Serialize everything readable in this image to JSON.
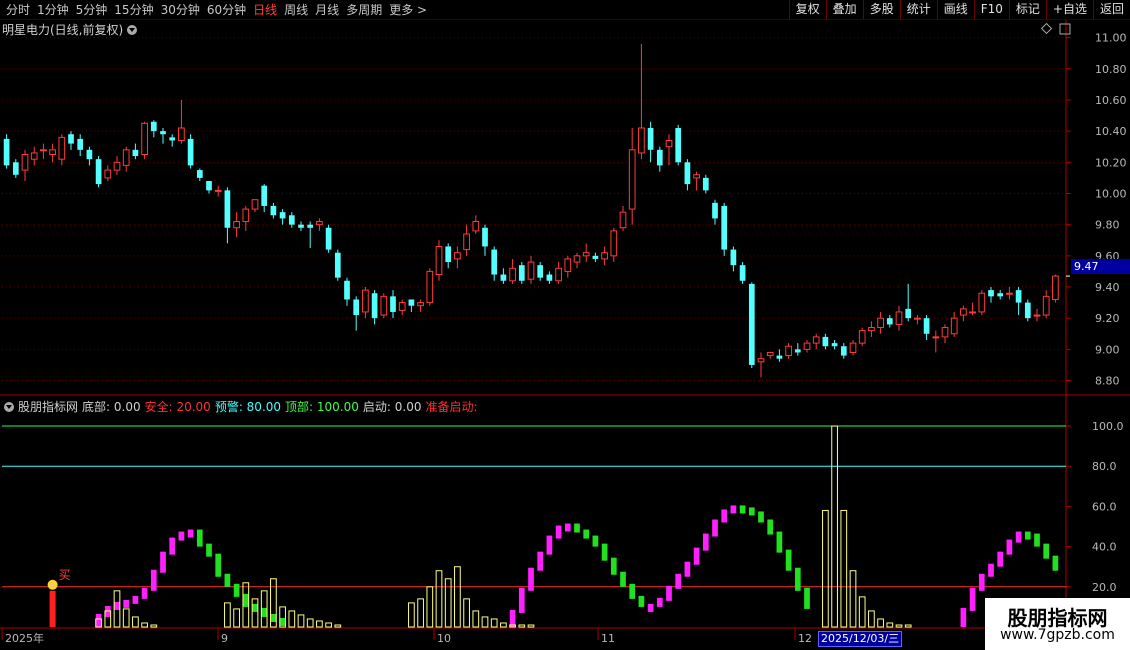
{
  "toolbar": {
    "periods": [
      "分时",
      "1分钟",
      "5分钟",
      "15分钟",
      "30分钟",
      "60分钟",
      "日线",
      "周线",
      "月线",
      "多周期",
      "更多 >"
    ],
    "active_period": "日线",
    "tools": [
      "复权",
      "叠加",
      "多股",
      "统计",
      "画线",
      "F10",
      "标记",
      "+自选",
      "返回"
    ]
  },
  "main_panel": {
    "title": "明星电力(日线,前复权)",
    "last_price": "9.47",
    "colors": {
      "up": "#ff3b3b",
      "down": "#54ffff",
      "grid": "#7a0000",
      "axis": "#b00000"
    }
  },
  "indicator_panel": {
    "name": "股朋指标网",
    "fields": [
      {
        "label": "底部:",
        "value": "0.00",
        "color": "#d0d0d0"
      },
      {
        "label": "安全:",
        "value": "20.00",
        "color": "#ff3030"
      },
      {
        "label": "预警:",
        "value": "80.00",
        "color": "#40ffff"
      },
      {
        "label": "顶部:",
        "value": "100.00",
        "color": "#40ff40"
      },
      {
        "label": "启动:",
        "value": "0.00",
        "color": "#d0d0d0"
      },
      {
        "label": "准备启动:",
        "value": "",
        "color": "#ff3030"
      }
    ],
    "signal_label": "买"
  },
  "x_axis": {
    "labels": [
      "2025年",
      "9",
      "10",
      "11",
      "12"
    ],
    "cursor_date": "2025/12/03/三"
  },
  "watermark": {
    "line1": "股朋指标网",
    "line2": "www.7gpzb.com"
  },
  "chart_data": {
    "type": "candlestick",
    "title": "明星电力(日线,前复权)",
    "y_ticks": [
      8.8,
      9.0,
      9.2,
      9.4,
      9.6,
      9.8,
      10.0,
      10.2,
      10.4,
      10.6,
      10.8,
      11.0
    ],
    "ylim": [
      8.72,
      11.1
    ],
    "candles": [
      [
        10.35,
        10.18,
        10.38,
        10.16
      ],
      [
        10.2,
        10.12,
        10.22,
        10.1
      ],
      [
        10.15,
        10.25,
        10.28,
        10.08
      ],
      [
        10.22,
        10.26,
        10.3,
        10.18
      ],
      [
        10.28,
        10.28,
        10.32,
        10.22
      ],
      [
        10.25,
        10.28,
        10.32,
        10.2
      ],
      [
        10.22,
        10.36,
        10.38,
        10.18
      ],
      [
        10.38,
        10.32,
        10.4,
        10.28
      ],
      [
        10.35,
        10.28,
        10.38,
        10.24
      ],
      [
        10.28,
        10.22,
        10.3,
        10.18
      ],
      [
        10.22,
        10.06,
        10.24,
        10.04
      ],
      [
        10.1,
        10.15,
        10.18,
        10.08
      ],
      [
        10.15,
        10.2,
        10.24,
        10.12
      ],
      [
        10.18,
        10.28,
        10.3,
        10.14
      ],
      [
        10.28,
        10.24,
        10.32,
        10.22
      ],
      [
        10.25,
        10.45,
        10.46,
        10.22
      ],
      [
        10.46,
        10.4,
        10.47,
        10.36
      ],
      [
        10.4,
        10.38,
        10.42,
        10.32
      ],
      [
        10.36,
        10.34,
        10.38,
        10.3
      ],
      [
        10.34,
        10.42,
        10.6,
        10.32
      ],
      [
        10.35,
        10.18,
        10.38,
        10.16
      ],
      [
        10.15,
        10.1,
        10.16,
        10.08
      ],
      [
        10.08,
        10.02,
        10.08,
        10.0
      ],
      [
        10.02,
        10.02,
        10.05,
        9.98
      ],
      [
        10.02,
        9.78,
        10.04,
        9.68
      ],
      [
        9.78,
        9.82,
        9.88,
        9.72
      ],
      [
        9.82,
        9.9,
        9.92,
        9.76
      ],
      [
        9.9,
        9.96,
        9.96,
        9.88
      ],
      [
        10.05,
        9.92,
        10.06,
        9.88
      ],
      [
        9.92,
        9.86,
        9.94,
        9.84
      ],
      [
        9.88,
        9.84,
        9.9,
        9.8
      ],
      [
        9.86,
        9.8,
        9.88,
        9.78
      ],
      [
        9.8,
        9.78,
        9.82,
        9.76
      ],
      [
        9.8,
        9.78,
        9.82,
        9.65
      ],
      [
        9.8,
        9.82,
        9.84,
        9.76
      ],
      [
        9.78,
        9.64,
        9.8,
        9.62
      ],
      [
        9.62,
        9.46,
        9.64,
        9.44
      ],
      [
        9.44,
        9.32,
        9.46,
        9.28
      ],
      [
        9.32,
        9.22,
        9.34,
        9.12
      ],
      [
        9.24,
        9.38,
        9.4,
        9.2
      ],
      [
        9.36,
        9.2,
        9.38,
        9.16
      ],
      [
        9.22,
        9.34,
        9.36,
        9.2
      ],
      [
        9.34,
        9.24,
        9.38,
        9.2
      ],
      [
        9.25,
        9.3,
        9.32,
        9.22
      ],
      [
        9.32,
        9.28,
        9.32,
        9.24
      ],
      [
        9.28,
        9.3,
        9.32,
        9.24
      ],
      [
        9.3,
        9.5,
        9.52,
        9.28
      ],
      [
        9.48,
        9.66,
        9.7,
        9.44
      ],
      [
        9.66,
        9.56,
        9.68,
        9.52
      ],
      [
        9.58,
        9.62,
        9.66,
        9.52
      ],
      [
        9.64,
        9.74,
        9.8,
        9.6
      ],
      [
        9.76,
        9.82,
        9.86,
        9.74
      ],
      [
        9.78,
        9.66,
        9.8,
        9.6
      ],
      [
        9.64,
        9.48,
        9.66,
        9.44
      ],
      [
        9.48,
        9.44,
        9.52,
        9.42
      ],
      [
        9.44,
        9.52,
        9.58,
        9.42
      ],
      [
        9.54,
        9.44,
        9.56,
        9.42
      ],
      [
        9.45,
        9.56,
        9.6,
        9.42
      ],
      [
        9.54,
        9.46,
        9.56,
        9.44
      ],
      [
        9.48,
        9.44,
        9.5,
        9.42
      ],
      [
        9.44,
        9.52,
        9.56,
        9.42
      ],
      [
        9.5,
        9.58,
        9.6,
        9.46
      ],
      [
        9.56,
        9.6,
        9.62,
        9.52
      ],
      [
        9.6,
        9.62,
        9.68,
        9.56
      ],
      [
        9.6,
        9.58,
        9.62,
        9.56
      ],
      [
        9.58,
        9.62,
        9.66,
        9.54
      ],
      [
        9.6,
        9.76,
        9.78,
        9.56
      ],
      [
        9.78,
        9.88,
        9.92,
        9.76
      ],
      [
        9.9,
        10.28,
        10.42,
        9.8
      ],
      [
        10.26,
        10.42,
        10.96,
        10.22
      ],
      [
        10.42,
        10.28,
        10.46,
        10.2
      ],
      [
        10.28,
        10.18,
        10.3,
        10.14
      ],
      [
        10.3,
        10.34,
        10.38,
        10.18
      ],
      [
        10.42,
        10.2,
        10.44,
        10.18
      ],
      [
        10.2,
        10.06,
        10.22,
        10.02
      ],
      [
        10.1,
        10.12,
        10.14,
        10.02
      ],
      [
        10.1,
        10.02,
        10.12,
        10.0
      ],
      [
        9.94,
        9.84,
        9.96,
        9.8
      ],
      [
        9.92,
        9.64,
        9.94,
        9.6
      ],
      [
        9.64,
        9.54,
        9.66,
        9.5
      ],
      [
        9.54,
        9.44,
        9.56,
        9.42
      ],
      [
        9.42,
        8.9,
        9.43,
        8.88
      ],
      [
        8.92,
        8.94,
        8.98,
        8.82
      ],
      [
        8.96,
        8.98,
        8.98,
        8.94
      ],
      [
        8.96,
        8.94,
        9.0,
        8.92
      ],
      [
        8.96,
        9.02,
        9.04,
        8.94
      ],
      [
        9.0,
        8.98,
        9.04,
        8.96
      ],
      [
        9.0,
        9.04,
        9.06,
        8.98
      ],
      [
        9.04,
        9.08,
        9.1,
        9.0
      ],
      [
        9.08,
        9.02,
        9.1,
        9.0
      ],
      [
        9.04,
        9.02,
        9.06,
        9.0
      ],
      [
        9.02,
        8.96,
        9.04,
        8.94
      ],
      [
        8.98,
        9.04,
        9.06,
        8.96
      ],
      [
        9.04,
        9.12,
        9.14,
        9.02
      ],
      [
        9.12,
        9.14,
        9.18,
        9.08
      ],
      [
        9.14,
        9.2,
        9.24,
        9.1
      ],
      [
        9.2,
        9.16,
        9.22,
        9.14
      ],
      [
        9.16,
        9.24,
        9.28,
        9.12
      ],
      [
        9.26,
        9.2,
        9.42,
        9.18
      ],
      [
        9.2,
        9.2,
        9.22,
        9.16
      ],
      [
        9.2,
        9.1,
        9.22,
        9.06
      ],
      [
        9.08,
        9.08,
        9.12,
        8.98
      ],
      [
        9.08,
        9.14,
        9.16,
        9.04
      ],
      [
        9.1,
        9.2,
        9.24,
        9.08
      ],
      [
        9.22,
        9.26,
        9.28,
        9.18
      ],
      [
        9.24,
        9.24,
        9.3,
        9.22
      ],
      [
        9.24,
        9.36,
        9.38,
        9.22
      ],
      [
        9.38,
        9.34,
        9.4,
        9.3
      ],
      [
        9.36,
        9.34,
        9.38,
        9.32
      ],
      [
        9.36,
        9.36,
        9.4,
        9.32
      ],
      [
        9.38,
        9.3,
        9.4,
        9.22
      ],
      [
        9.3,
        9.2,
        9.32,
        9.18
      ],
      [
        9.22,
        9.22,
        9.26,
        9.18
      ],
      [
        9.22,
        9.34,
        9.38,
        9.2
      ],
      [
        9.32,
        9.47,
        9.48,
        9.3
      ]
    ],
    "indicator": {
      "levels": {
        "bottom": 0,
        "safe": 20,
        "warn": 80,
        "top": 100
      },
      "ylim": [
        0,
        104
      ],
      "y_ticks": [
        20,
        40,
        60,
        80,
        100
      ],
      "buy_signal_index": 5,
      "oscillator": [
        0,
        0,
        0,
        0,
        0,
        0,
        0,
        0,
        0,
        0,
        5,
        9,
        11,
        12,
        14,
        18,
        27,
        36,
        43,
        46,
        47,
        40,
        35,
        25,
        20,
        15,
        10,
        8,
        5,
        3,
        2,
        0,
        0,
        0,
        0,
        0,
        0,
        0,
        0,
        0,
        0,
        0,
        0,
        0,
        0,
        0,
        0,
        0,
        0,
        0,
        0,
        0,
        0,
        0,
        0,
        7,
        18,
        28,
        36,
        44,
        49,
        50,
        47,
        44,
        40,
        33,
        26,
        20,
        14,
        10,
        10,
        13,
        19,
        25,
        31,
        38,
        45,
        52,
        57,
        59,
        58,
        56,
        52,
        46,
        37,
        28,
        18,
        9,
        0,
        0,
        0,
        0,
        0,
        0,
        0,
        0,
        0,
        0,
        0,
        0,
        0,
        0,
        0,
        0,
        8,
        18,
        25,
        30,
        36,
        42,
        46,
        45,
        40,
        34,
        28,
        26,
        26,
        28,
        34,
        42,
        49,
        54,
        55,
        52,
        52,
        58
      ],
      "osc_color_up": "#ff20ff",
      "osc_color_down": "#20e020",
      "volume_like": [
        0,
        0,
        0,
        0,
        0,
        0,
        0,
        0,
        0,
        0,
        2,
        6,
        8,
        14,
        18,
        10,
        6,
        3,
        2,
        1,
        0,
        0,
        0,
        0,
        0,
        0,
        0,
        0,
        0,
        0,
        0,
        0,
        0,
        0,
        0,
        0,
        0,
        0,
        0,
        0,
        0,
        0,
        0,
        0,
        0,
        0,
        0,
        0,
        0,
        0,
        0,
        0,
        0,
        0,
        0,
        0,
        0,
        0,
        0,
        0,
        0,
        0,
        0,
        0,
        0,
        0,
        0,
        0,
        0,
        0,
        0,
        0,
        0,
        0,
        0,
        0,
        0,
        0,
        0,
        0,
        0,
        0,
        0,
        0,
        0,
        0,
        0,
        0,
        0,
        0,
        0,
        0,
        0,
        0,
        0,
        0,
        0,
        0,
        0,
        0,
        0,
        0,
        0,
        0,
        0,
        0,
        0,
        0,
        0,
        0,
        0,
        0,
        0,
        0,
        0,
        0,
        0,
        0,
        0,
        0,
        0,
        0,
        0,
        0,
        0
      ]
    }
  }
}
